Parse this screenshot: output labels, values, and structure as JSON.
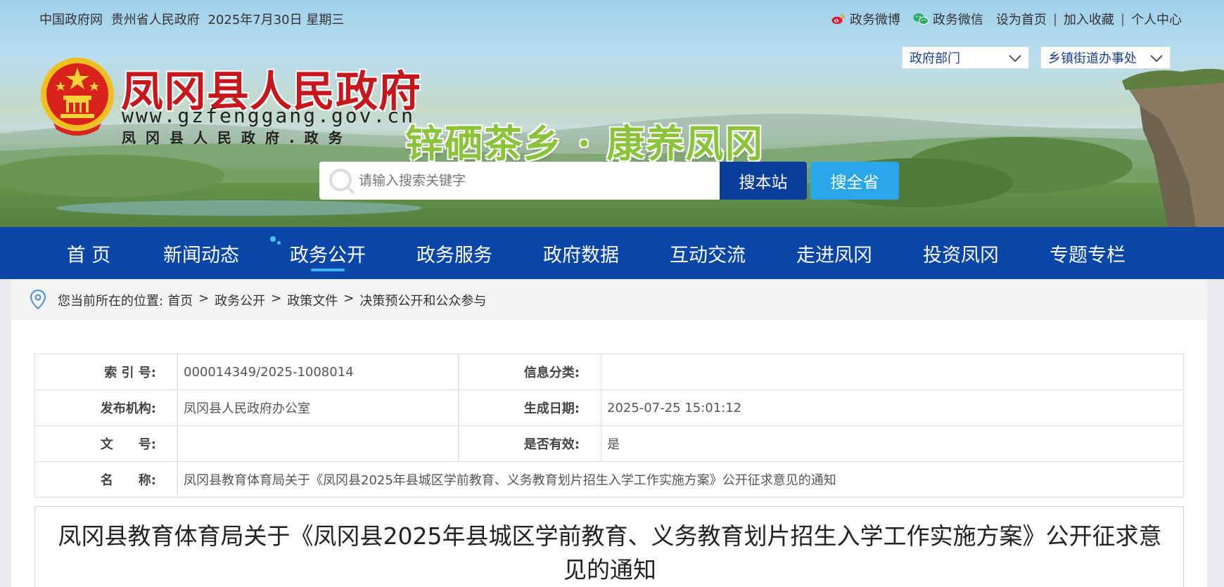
{
  "topbar": {
    "left_items": [
      "中国政府网",
      "贵州省人民政府",
      "2025年7月30日 星期三"
    ],
    "weibo": "政务微博",
    "wechat": "政务微信",
    "links": [
      "设为首页",
      "加入收藏",
      "个人中心"
    ],
    "separator": "|"
  },
  "selects": {
    "dept": "政府部门",
    "town": "乡镇街道办事处"
  },
  "site": {
    "title": "凤冈县人民政府",
    "url": "www.gzfenggang.gov.cn",
    "subtitle": "凤冈县人民政府.政务",
    "slogan": "锌硒茶乡 · 康养凤冈"
  },
  "search": {
    "placeholder": "请输入搜索关键字",
    "btn_site": "搜本站",
    "btn_province": "搜全省"
  },
  "nav": {
    "items": [
      {
        "label": "首 页"
      },
      {
        "label": "新闻动态"
      },
      {
        "label": "政务公开"
      },
      {
        "label": "政务服务"
      },
      {
        "label": "政府数据"
      },
      {
        "label": "互动交流"
      },
      {
        "label": "走进凤冈"
      },
      {
        "label": "投资凤冈"
      },
      {
        "label": "专题专栏"
      }
    ],
    "active_index": 2
  },
  "breadcrumb": {
    "prefix": "您当前所在的位置:",
    "items": [
      "首页",
      "政务公开",
      "政策文件",
      "决策预公开和公众参与"
    ],
    "separator": ">"
  },
  "meta": {
    "index_label": "索 引 号:",
    "index_value": "000014349/2025-1008014",
    "category_label": "信息分类:",
    "category_value": "",
    "publisher_label": "发布机构:",
    "publisher_value": "凤冈县人民政府办公室",
    "date_label": "生成日期:",
    "date_value": "2025-07-25 15:01:12",
    "docno_label": "文　　号:",
    "docno_value": "",
    "valid_label": "是否有效:",
    "valid_value": "是",
    "name_label": "名　　称:",
    "name_value": "凤冈县教育体育局关于《凤冈县2025年县城区学前教育、义务教育划片招生入学工作实施方案》公开征求意见的通知"
  },
  "article": {
    "title": "凤冈县教育体育局关于《凤冈县2025年县城区学前教育、义务教育划片招生入学工作实施方案》公开征求意见的通知"
  },
  "colors": {
    "nav_bg": "#0a46a8",
    "title_red": "#c8161d",
    "slogan_green": "#8bc43a",
    "btn_site": "#0a3d9c",
    "btn_province": "#2aa7e8"
  }
}
